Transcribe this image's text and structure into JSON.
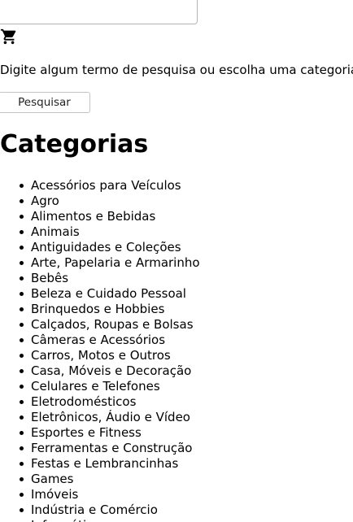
{
  "search": {
    "placeholder": "",
    "value": ""
  },
  "cart_icon": "shopping-cart-icon",
  "hint_text": "Digite algum termo de pesquisa ou escolha uma categoria.",
  "search_button_label": "Pesquisar",
  "categories_title": "Categorias",
  "categories": [
    "Acessórios para Veículos",
    "Agro",
    "Alimentos e Bebidas",
    "Animais",
    "Antiguidades e Coleções",
    "Arte, Papelaria e Armarinho",
    "Bebês",
    "Beleza e Cuidado Pessoal",
    "Brinquedos e Hobbies",
    "Calçados, Roupas e Bolsas",
    "Câmeras e Acessórios",
    "Carros, Motos e Outros",
    "Casa, Móveis e Decoração",
    "Celulares e Telefones",
    "Eletrodomésticos",
    "Eletrônicos, Áudio e Vídeo",
    "Esportes e Fitness",
    "Ferramentas e Construção",
    "Festas e Lembrancinhas",
    "Games",
    "Imóveis",
    "Indústria e Comércio",
    "Informática"
  ]
}
